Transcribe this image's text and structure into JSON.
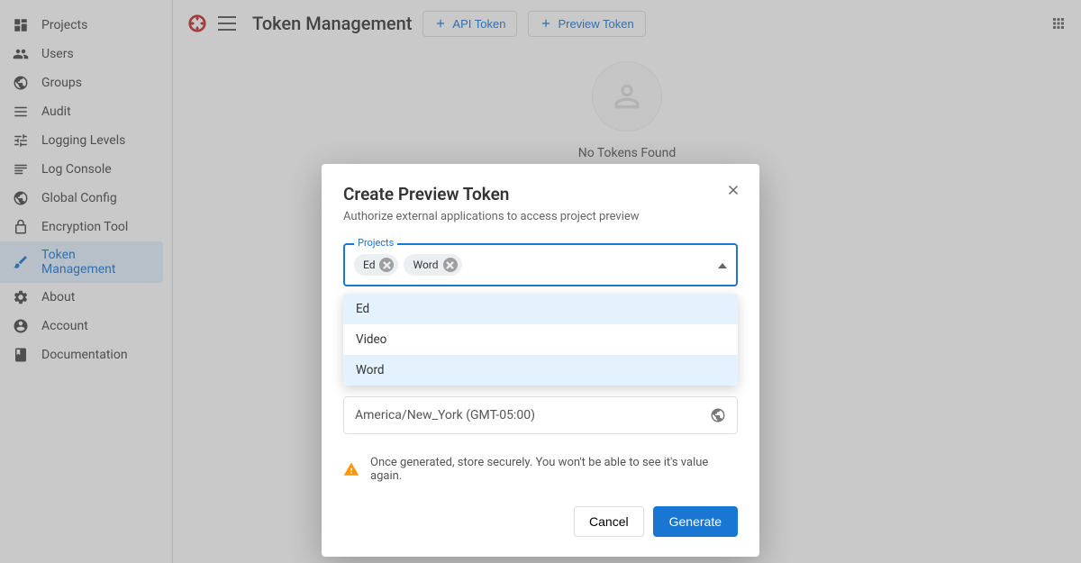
{
  "sidebar": {
    "items": [
      {
        "label": "Projects"
      },
      {
        "label": "Users"
      },
      {
        "label": "Groups"
      },
      {
        "label": "Audit"
      },
      {
        "label": "Logging Levels"
      },
      {
        "label": "Log Console"
      },
      {
        "label": "Global Config"
      },
      {
        "label": "Encryption Tool"
      },
      {
        "label": "Token Management"
      },
      {
        "label": "About"
      },
      {
        "label": "Account"
      },
      {
        "label": "Documentation"
      }
    ]
  },
  "header": {
    "title": "Token Management",
    "api_token_btn": "API Token",
    "preview_token_btn": "Preview Token"
  },
  "main": {
    "empty_text": "No Tokens Found"
  },
  "dialog": {
    "title": "Create Preview Token",
    "subtitle": "Authorize external applications to access project preview",
    "projects_label": "Projects",
    "chips": [
      "Ed",
      "Word"
    ],
    "options": [
      "Ed",
      "Video",
      "Word"
    ],
    "timezone": "America/New_York (GMT-05:00)",
    "warning": "Once generated, store securely. You won't be able to see it's value again.",
    "cancel": "Cancel",
    "generate": "Generate"
  }
}
